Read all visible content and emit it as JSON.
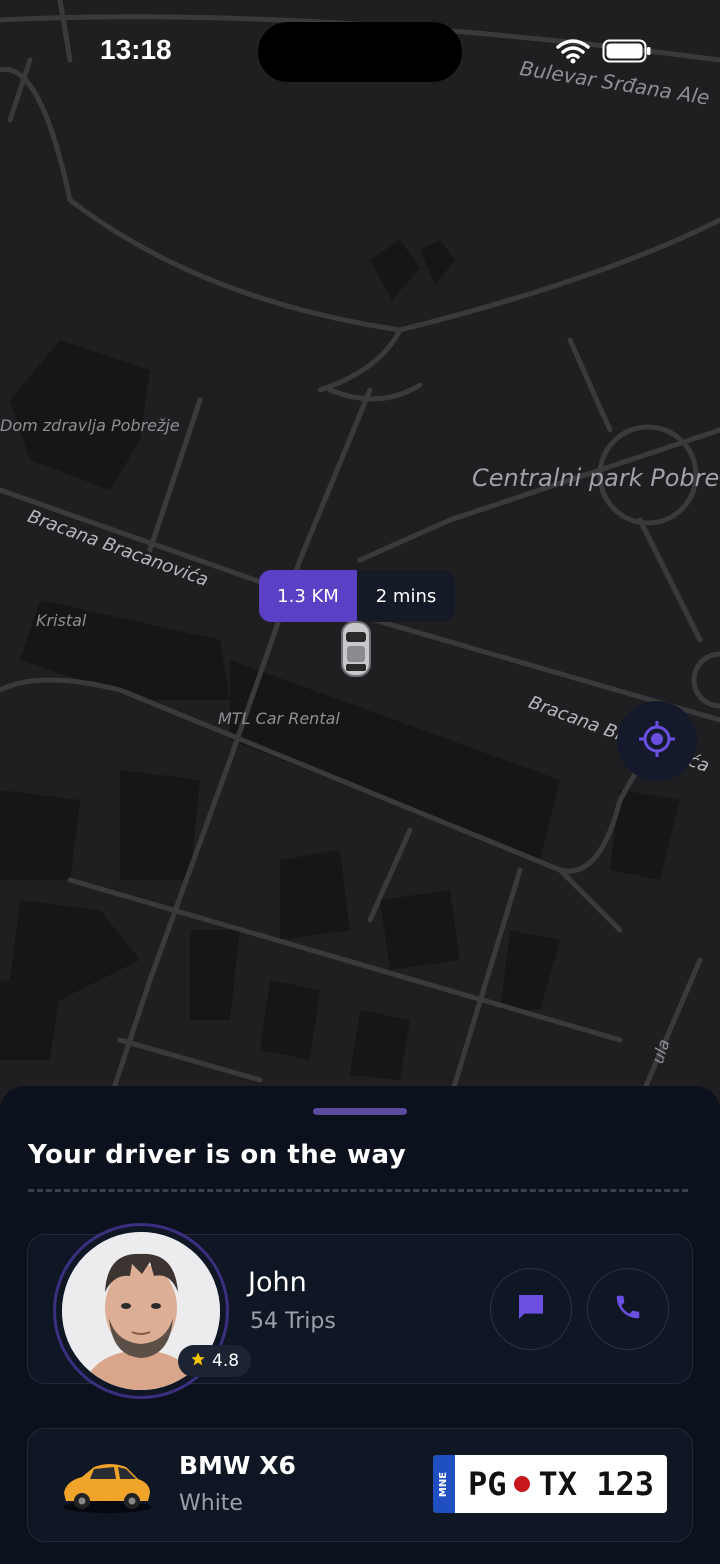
{
  "status_bar": {
    "time": "13:18"
  },
  "map": {
    "labels": {
      "boulevard": "Bulevar Srđana Ale",
      "health_center": "Dom zdravlja Pobrežje",
      "park": "Centralni park Pobre",
      "street_main": "Bracana Bracanovića",
      "kristal": "Kristal",
      "car_rental": "MTL Car Rental",
      "street_right": "Bracana Bracanovića",
      "street_vertical": "ula"
    },
    "eta": {
      "distance": "1.3 KM",
      "time": "2 mins"
    },
    "icons": {
      "locate": "locate-target-icon",
      "car": "car-marker-icon"
    }
  },
  "sheet": {
    "title": "Your driver is on the way",
    "driver": {
      "name": "John",
      "trips": "54 Trips",
      "rating": "4.8",
      "message_icon": "message-icon",
      "call_icon": "phone-icon"
    },
    "vehicle": {
      "model": "BMW X6",
      "color": "White",
      "plate_country": "MNE",
      "plate_left": "PG",
      "plate_right": "TX 123"
    }
  },
  "colors": {
    "accent": "#5b3fc4",
    "sheet_bg": "#0b111d",
    "map_bg": "#1c1c1e",
    "star": "#f5c400"
  }
}
